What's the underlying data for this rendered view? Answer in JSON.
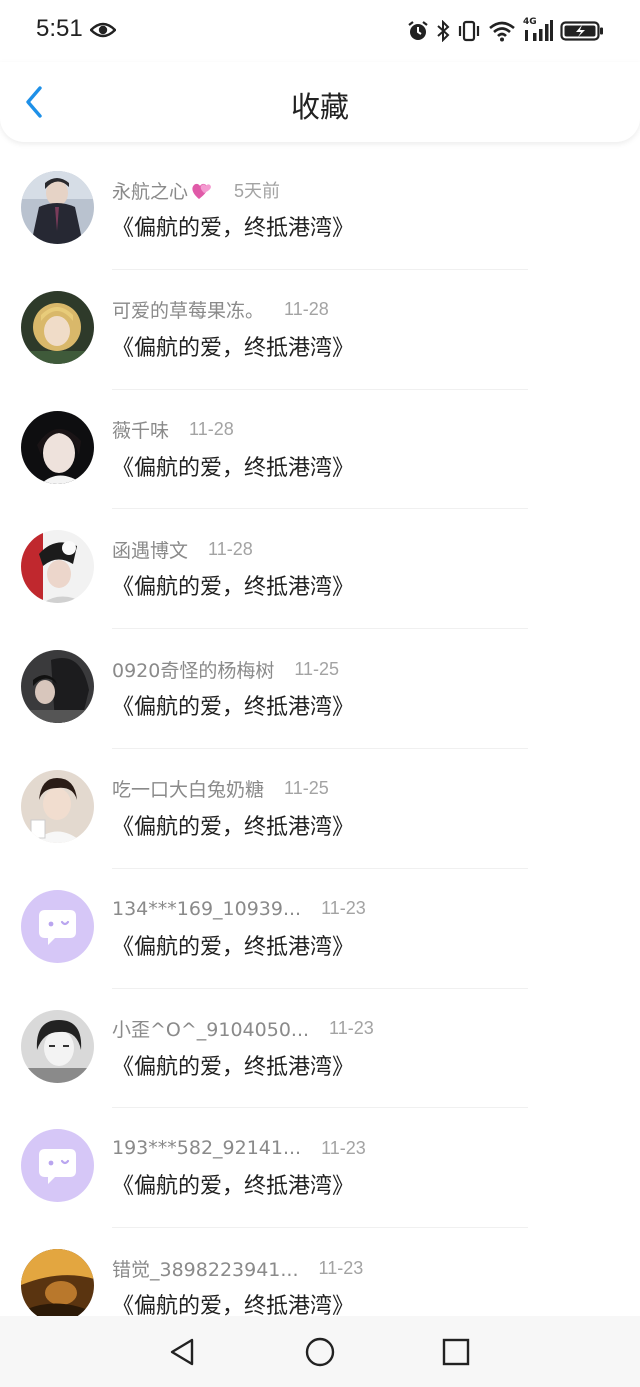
{
  "status": {
    "time": "5:51",
    "network": "4G"
  },
  "header": {
    "title": "收藏"
  },
  "items": [
    {
      "user": "永航之心",
      "time": "5天前",
      "title": "《偏航的爱，终抵港湾》",
      "avatar": "photo-dark-suit",
      "has_heart": true
    },
    {
      "user": "可爱的草莓果冻。",
      "time": "11-28",
      "title": "《偏航的爱，终抵港湾》",
      "avatar": "photo-blonde-doll"
    },
    {
      "user": "薇千味",
      "time": "11-28",
      "title": "《偏航的爱，终抵港湾》",
      "avatar": "photo-dark-hair"
    },
    {
      "user": "函遇博文",
      "time": "11-28",
      "title": "《偏航的爱，终抵港湾》",
      "avatar": "photo-red-black"
    },
    {
      "user": "0920奇怪的杨梅树",
      "time": "11-25",
      "title": "《偏航的爱，终抵港湾》",
      "avatar": "photo-couple-dark"
    },
    {
      "user": "吃一口大白兔奶糖",
      "time": "11-25",
      "title": "《偏航的爱，终抵港湾》",
      "avatar": "photo-boy-curly"
    },
    {
      "user": "134***169_10939...",
      "time": "11-23",
      "title": "《偏航的爱，终抵港湾》",
      "avatar": "default-chat"
    },
    {
      "user": "小歪^O^_9104050...",
      "time": "11-23",
      "title": "《偏航的爱，终抵港湾》",
      "avatar": "photo-girl-bw"
    },
    {
      "user": "193***582_92141...",
      "time": "11-23",
      "title": "《偏航的爱，终抵港湾》",
      "avatar": "default-chat"
    },
    {
      "user": "错觉_3898223941...",
      "time": "11-23",
      "title": "《偏航的爱，终抵港湾》",
      "avatar": "photo-amber"
    }
  ],
  "colors": {
    "accent": "#1e90e8",
    "default_avatar_bg": "#d6c7f7"
  }
}
